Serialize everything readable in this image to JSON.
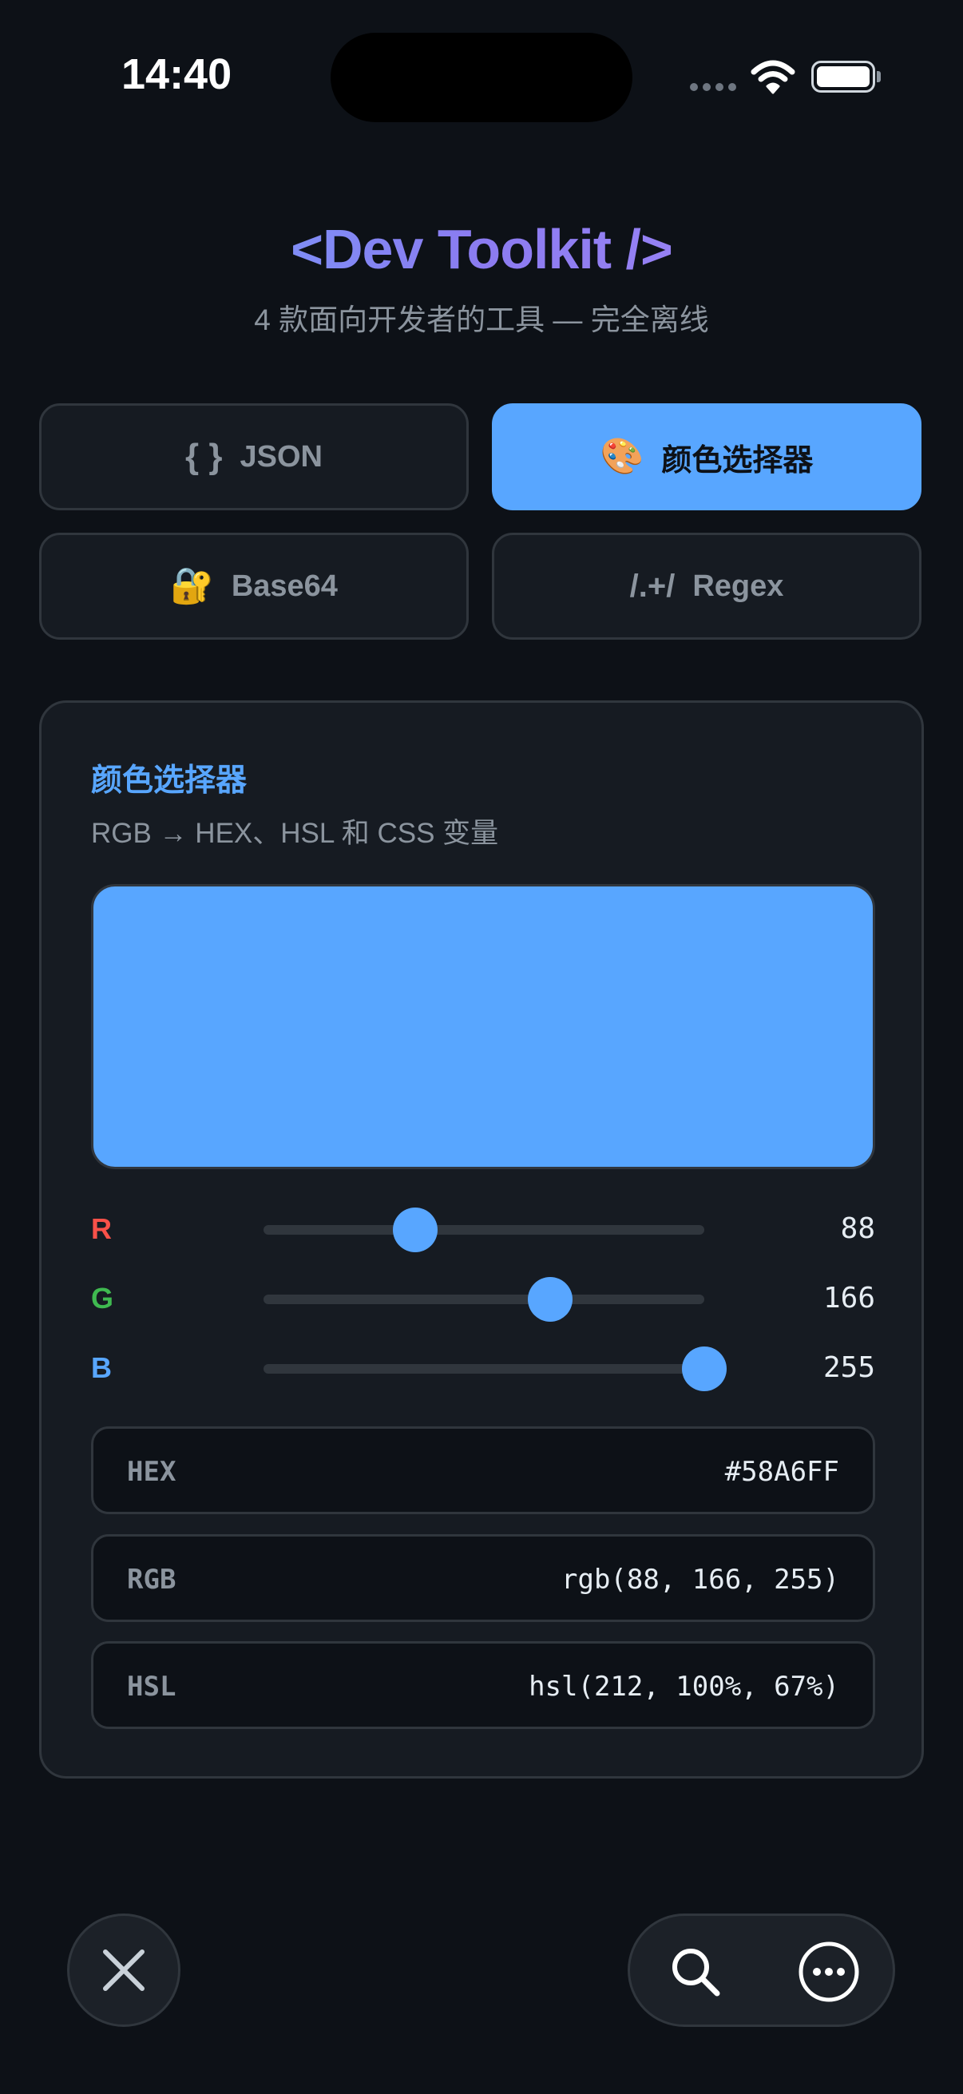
{
  "status_bar": {
    "time": "14:40"
  },
  "header": {
    "title": "<Dev Toolkit />",
    "subtitle": "4 款面向开发者的工具 — 完全离线"
  },
  "tabs": [
    {
      "icon": "{ }",
      "label": "JSON",
      "active": false
    },
    {
      "icon": "🎨",
      "label": "颜色选择器",
      "active": true
    },
    {
      "icon": "🔐",
      "label": "Base64",
      "active": false
    },
    {
      "icon": "/.+/",
      "label": "Regex",
      "active": false
    }
  ],
  "panel": {
    "title": "颜色选择器",
    "description": "RGB → HEX、HSL 和 CSS 变量",
    "swatch_color": "#58A6FF",
    "sliders": [
      {
        "label": "R",
        "value": 88,
        "max": 255,
        "label_color": "#f85149"
      },
      {
        "label": "G",
        "value": 166,
        "max": 255,
        "label_color": "#3fb950"
      },
      {
        "label": "B",
        "value": 255,
        "max": 255,
        "label_color": "#58a6ff"
      }
    ],
    "outputs": [
      {
        "key": "HEX",
        "value": "#58A6FF"
      },
      {
        "key": "RGB",
        "value": "rgb(88, 166, 255)"
      },
      {
        "key": "HSL",
        "value": "hsl(212, 100%, 67%)"
      }
    ]
  },
  "toolbar": {
    "close_icon": "close-icon",
    "search_icon": "search-icon",
    "more_icon": "more-icon"
  },
  "colors": {
    "background": "#0d1117",
    "accent": "#58a6ff",
    "panel": "#161b22",
    "border": "#30363d"
  }
}
